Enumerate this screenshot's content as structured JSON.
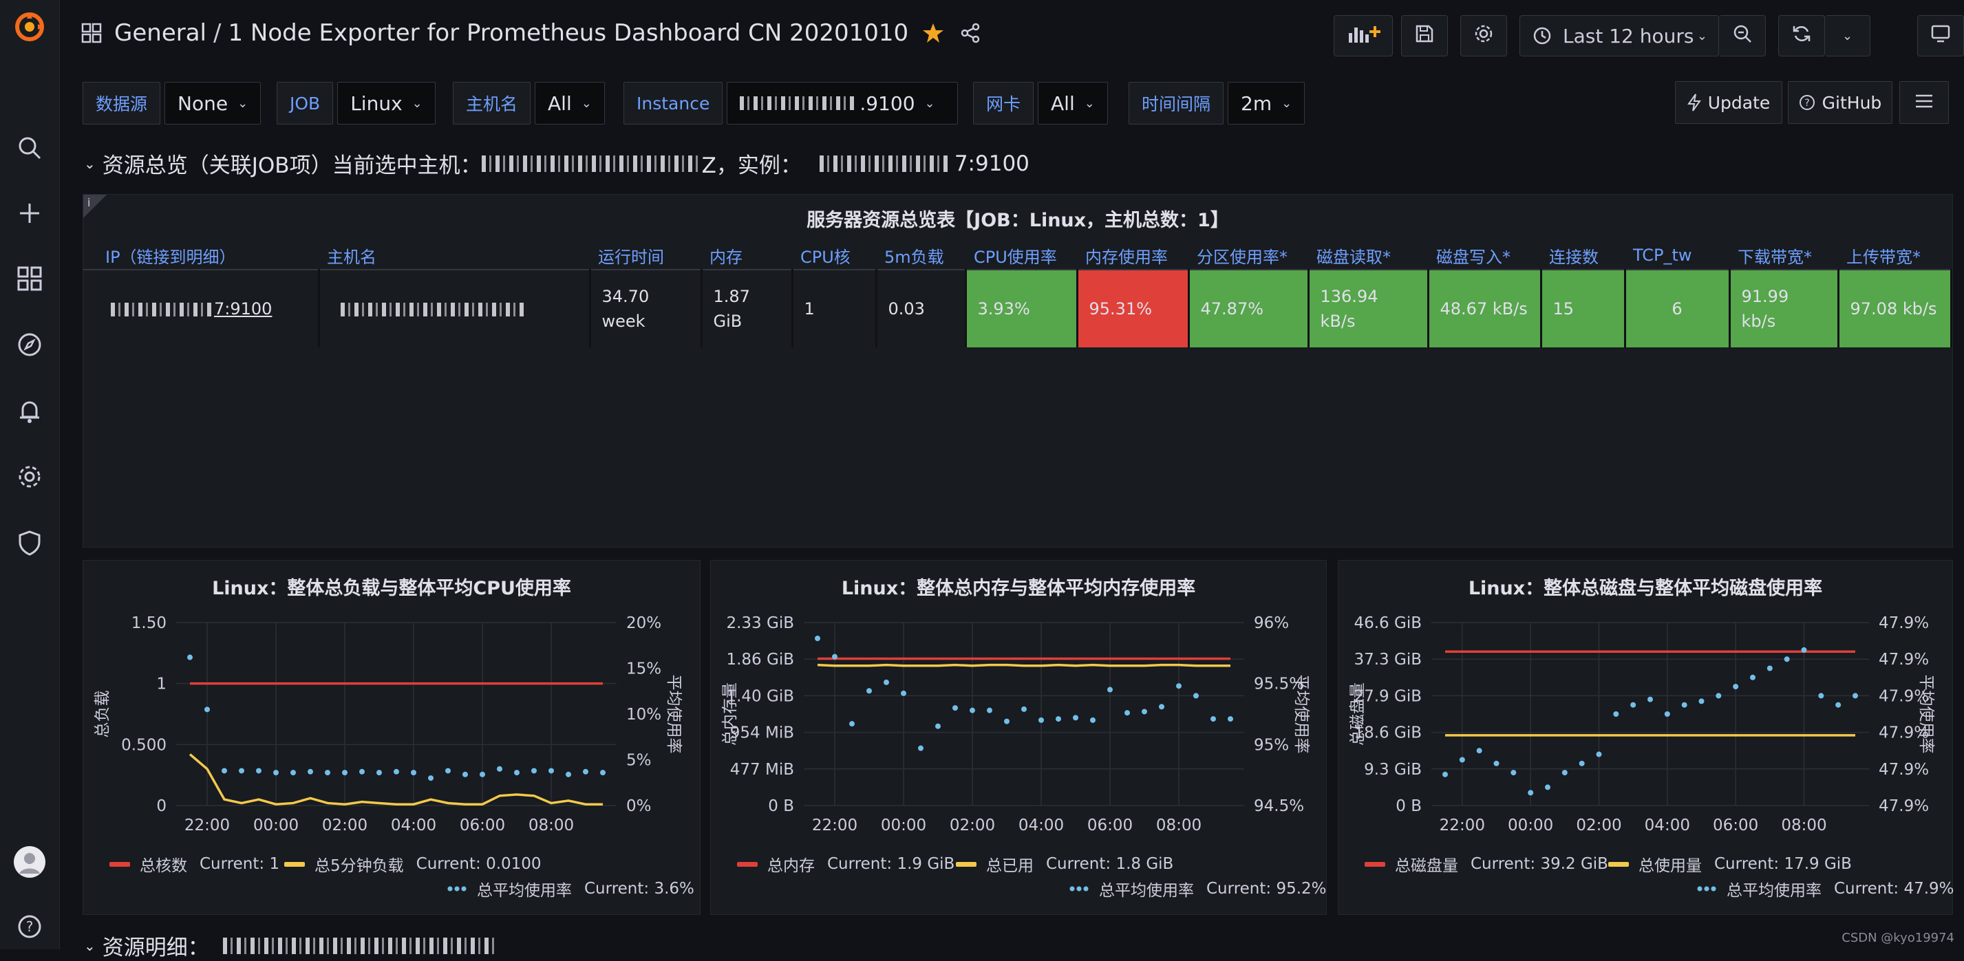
{
  "topbar": {
    "crumb_folder": "General",
    "crumb_title": "1 Node Exporter for Prometheus Dashboard CN 20201010",
    "time_range": "Last 12 hours"
  },
  "variables": [
    {
      "label": "数据源",
      "value": "None"
    },
    {
      "label": "JOB",
      "value": "Linux"
    },
    {
      "label": "主机名",
      "value": "All"
    },
    {
      "label": "Instance",
      "value": ".9100"
    },
    {
      "label": "网卡",
      "value": "All"
    },
    {
      "label": "时间间隔",
      "value": "2m"
    }
  ],
  "links": {
    "update": "Update",
    "github": "GitHub"
  },
  "rows": {
    "overview_prefix": "资源总览（关联JOB项）当前选中主机：",
    "overview_suffix": "Z，实例：",
    "overview_instance_tail": "7:9100",
    "detail": "资源明细："
  },
  "server_table": {
    "title": "服务器资源总览表【JOB：Linux，主机总数：1】",
    "info": "i",
    "headers": [
      "IP（链接到明细）",
      "主机名",
      "运行时间",
      "内存",
      "CPU核",
      "5m负载",
      "CPU使用率",
      "内存使用率",
      "分区使用率*",
      "磁盘读取*",
      "磁盘写入*",
      "连接数",
      "TCP_tw",
      "下载带宽*",
      "上传带宽*"
    ],
    "row": {
      "ip_tail": "7:9100",
      "uptime": "34.70 week",
      "memory": "1.87 GiB",
      "cpu_cores": "1",
      "load5": "0.03",
      "cpu_usage": "3.93%",
      "mem_usage": "95.31%",
      "part_usage": "47.87%",
      "disk_read": "136.94 kB/s",
      "disk_write": "48.67 kB/s",
      "connections": "15",
      "tcp_tw": "6",
      "download": "91.99 kb/s",
      "upload": "97.08 kb/s"
    }
  },
  "colors": {
    "red": "#e0403a",
    "yellow": "#f2c94c",
    "blue": "#73bfe8",
    "green": "#56a64b",
    "accent": "#6e9fff"
  },
  "charts": [
    {
      "title": "Linux：整体总负载与整体平均CPU使用率",
      "ylabel_left": "总负载",
      "ylabel_right": "平均使用率",
      "yticks_left": [
        "0",
        "0.500",
        "1",
        "1.50"
      ],
      "yticks_right": [
        "0%",
        "5%",
        "10%",
        "15%",
        "20%"
      ],
      "xticks": [
        "22:00",
        "00:00",
        "02:00",
        "04:00",
        "06:00",
        "08:00"
      ],
      "legend": [
        {
          "name": "总核数",
          "current": "Current: 1"
        },
        {
          "name": "总5分钟负载",
          "current": "Current: 0.0100"
        },
        {
          "name": "总平均使用率",
          "current": "Current: 3.6%"
        }
      ]
    },
    {
      "title": "Linux：整体总内存与整体平均内存使用率",
      "ylabel_left": "总内存量",
      "ylabel_right": "平均使用率",
      "yticks_left": [
        "0 B",
        "477 MiB",
        "954 MiB",
        "1.40 GiB",
        "1.86 GiB",
        "2.33 GiB"
      ],
      "yticks_right": [
        "94.5%",
        "95%",
        "95.5%",
        "96%"
      ],
      "xticks": [
        "22:00",
        "00:00",
        "02:00",
        "04:00",
        "06:00",
        "08:00"
      ],
      "legend": [
        {
          "name": "总内存",
          "current": "Current: 1.9 GiB"
        },
        {
          "name": "总已用",
          "current": "Current: 1.8 GiB"
        },
        {
          "name": "总平均使用率",
          "current": "Current: 95.2%"
        }
      ]
    },
    {
      "title": "Linux：整体总磁盘与整体平均磁盘使用率",
      "ylabel_left": "总磁盘量",
      "ylabel_right": "平均使用率",
      "yticks_left": [
        "0 B",
        "9.3 GiB",
        "18.6 GiB",
        "27.9 GiB",
        "37.3 GiB",
        "46.6 GiB"
      ],
      "yticks_right": [
        "47.9%",
        "47.9%",
        "47.9%",
        "47.9%",
        "47.9%",
        "47.9%"
      ],
      "xticks": [
        "22:00",
        "00:00",
        "02:00",
        "04:00",
        "06:00",
        "08:00"
      ],
      "legend": [
        {
          "name": "总磁盘量",
          "current": "Current: 39.2 GiB"
        },
        {
          "name": "总使用量",
          "current": "Current: 17.9 GiB"
        },
        {
          "name": "总平均使用率",
          "current": "Current: 47.9%"
        }
      ]
    }
  ],
  "chart_data": [
    {
      "type": "line",
      "title": "Linux：整体总负载与整体平均CPU使用率",
      "x": [
        "21:30",
        "22:00",
        "22:30",
        "23:00",
        "23:30",
        "00:00",
        "00:30",
        "01:00",
        "01:30",
        "02:00",
        "02:30",
        "03:00",
        "03:30",
        "04:00",
        "04:30",
        "05:00",
        "05:30",
        "06:00",
        "06:30",
        "07:00",
        "07:30",
        "08:00",
        "08:30",
        "09:00",
        "09:30"
      ],
      "ylim_left": [
        0,
        1.5
      ],
      "ylim_right": [
        0,
        20
      ],
      "series": [
        {
          "name": "总核数",
          "axis": "left",
          "style": "line",
          "values": [
            1,
            1,
            1,
            1,
            1,
            1,
            1,
            1,
            1,
            1,
            1,
            1,
            1,
            1,
            1,
            1,
            1,
            1,
            1,
            1,
            1,
            1,
            1,
            1,
            1
          ]
        },
        {
          "name": "总5分钟负载",
          "axis": "left",
          "style": "line",
          "values": [
            0.42,
            0.3,
            0.05,
            0.02,
            0.05,
            0.01,
            0.02,
            0.06,
            0.02,
            0.01,
            0.03,
            0.02,
            0.01,
            0.01,
            0.05,
            0.02,
            0.01,
            0.01,
            0.08,
            0.09,
            0.08,
            0.02,
            0.04,
            0.01,
            0.01
          ]
        },
        {
          "name": "总平均使用率",
          "axis": "right",
          "style": "points",
          "values": [
            16.2,
            10.5,
            3.8,
            3.8,
            3.8,
            3.6,
            3.6,
            3.7,
            3.6,
            3.6,
            3.7,
            3.6,
            3.7,
            3.6,
            3.0,
            3.8,
            3.4,
            3.4,
            4.0,
            3.6,
            3.8,
            3.8,
            3.4,
            3.7,
            3.6
          ]
        }
      ]
    },
    {
      "type": "line",
      "title": "Linux：整体总内存与整体平均内存使用率",
      "x": [
        "21:30",
        "22:00",
        "22:30",
        "23:00",
        "23:30",
        "00:00",
        "00:30",
        "01:00",
        "01:30",
        "02:00",
        "02:30",
        "03:00",
        "03:30",
        "04:00",
        "04:30",
        "05:00",
        "05:30",
        "06:00",
        "06:30",
        "07:00",
        "07:30",
        "08:00",
        "08:30",
        "09:00",
        "09:30"
      ],
      "ylim_left_gib": [
        0,
        2.33
      ],
      "ylim_right": [
        94.5,
        96
      ],
      "series": [
        {
          "name": "总内存",
          "axis": "left",
          "style": "line",
          "unit": "GiB",
          "values": [
            1.87,
            1.87,
            1.87,
            1.87,
            1.87,
            1.87,
            1.87,
            1.87,
            1.87,
            1.87,
            1.87,
            1.87,
            1.87,
            1.87,
            1.87,
            1.87,
            1.87,
            1.87,
            1.87,
            1.87,
            1.87,
            1.87,
            1.87,
            1.87,
            1.87
          ]
        },
        {
          "name": "总已用",
          "axis": "left",
          "style": "line",
          "unit": "GiB",
          "values": [
            1.79,
            1.78,
            1.78,
            1.78,
            1.79,
            1.78,
            1.78,
            1.78,
            1.79,
            1.78,
            1.79,
            1.79,
            1.78,
            1.78,
            1.79,
            1.78,
            1.79,
            1.78,
            1.78,
            1.78,
            1.79,
            1.79,
            1.78,
            1.78,
            1.78
          ]
        },
        {
          "name": "总平均使用率",
          "axis": "right",
          "style": "points",
          "values": [
            95.87,
            95.72,
            95.17,
            95.44,
            95.51,
            95.42,
            94.97,
            95.15,
            95.3,
            95.28,
            95.28,
            95.19,
            95.29,
            95.2,
            95.21,
            95.22,
            95.2,
            95.45,
            95.26,
            95.27,
            95.31,
            95.48,
            95.4,
            95.21,
            95.21
          ]
        }
      ]
    },
    {
      "type": "line",
      "title": "Linux：整体总磁盘与整体平均磁盘使用率",
      "x": [
        "21:30",
        "22:00",
        "22:30",
        "23:00",
        "23:30",
        "00:00",
        "00:30",
        "01:00",
        "01:30",
        "02:00",
        "02:30",
        "03:00",
        "03:30",
        "04:00",
        "04:30",
        "05:00",
        "05:30",
        "06:00",
        "06:30",
        "07:00",
        "07:30",
        "08:00",
        "08:30",
        "09:00",
        "09:30"
      ],
      "ylim_left_gib": [
        0,
        46.6
      ],
      "series": [
        {
          "name": "总磁盘量",
          "axis": "left",
          "style": "line",
          "unit": "GiB",
          "values": [
            39.2,
            39.2,
            39.2,
            39.2,
            39.2,
            39.2,
            39.2,
            39.2,
            39.2,
            39.2,
            39.2,
            39.2,
            39.2,
            39.2,
            39.2,
            39.2,
            39.2,
            39.2,
            39.2,
            39.2,
            39.2,
            39.2,
            39.2,
            39.2,
            39.2
          ]
        },
        {
          "name": "总使用量",
          "axis": "left",
          "style": "line",
          "unit": "GiB",
          "values": [
            17.9,
            17.9,
            17.9,
            17.9,
            17.9,
            17.9,
            17.9,
            17.9,
            17.9,
            17.9,
            17.9,
            17.9,
            17.9,
            17.9,
            17.9,
            17.9,
            17.9,
            17.9,
            17.9,
            17.9,
            17.9,
            17.9,
            17.9,
            17.9,
            17.9
          ]
        },
        {
          "name": "总平均使用率",
          "axis": "right",
          "style": "points",
          "values_relative": [
            0.17,
            0.25,
            0.3,
            0.23,
            0.18,
            0.07,
            0.1,
            0.18,
            0.23,
            0.28,
            0.5,
            0.55,
            0.58,
            0.5,
            0.55,
            0.57,
            0.6,
            0.65,
            0.7,
            0.75,
            0.8,
            0.85,
            0.6,
            0.55,
            0.6
          ]
        }
      ]
    }
  ],
  "watermark": "CSDN @kyo19974"
}
